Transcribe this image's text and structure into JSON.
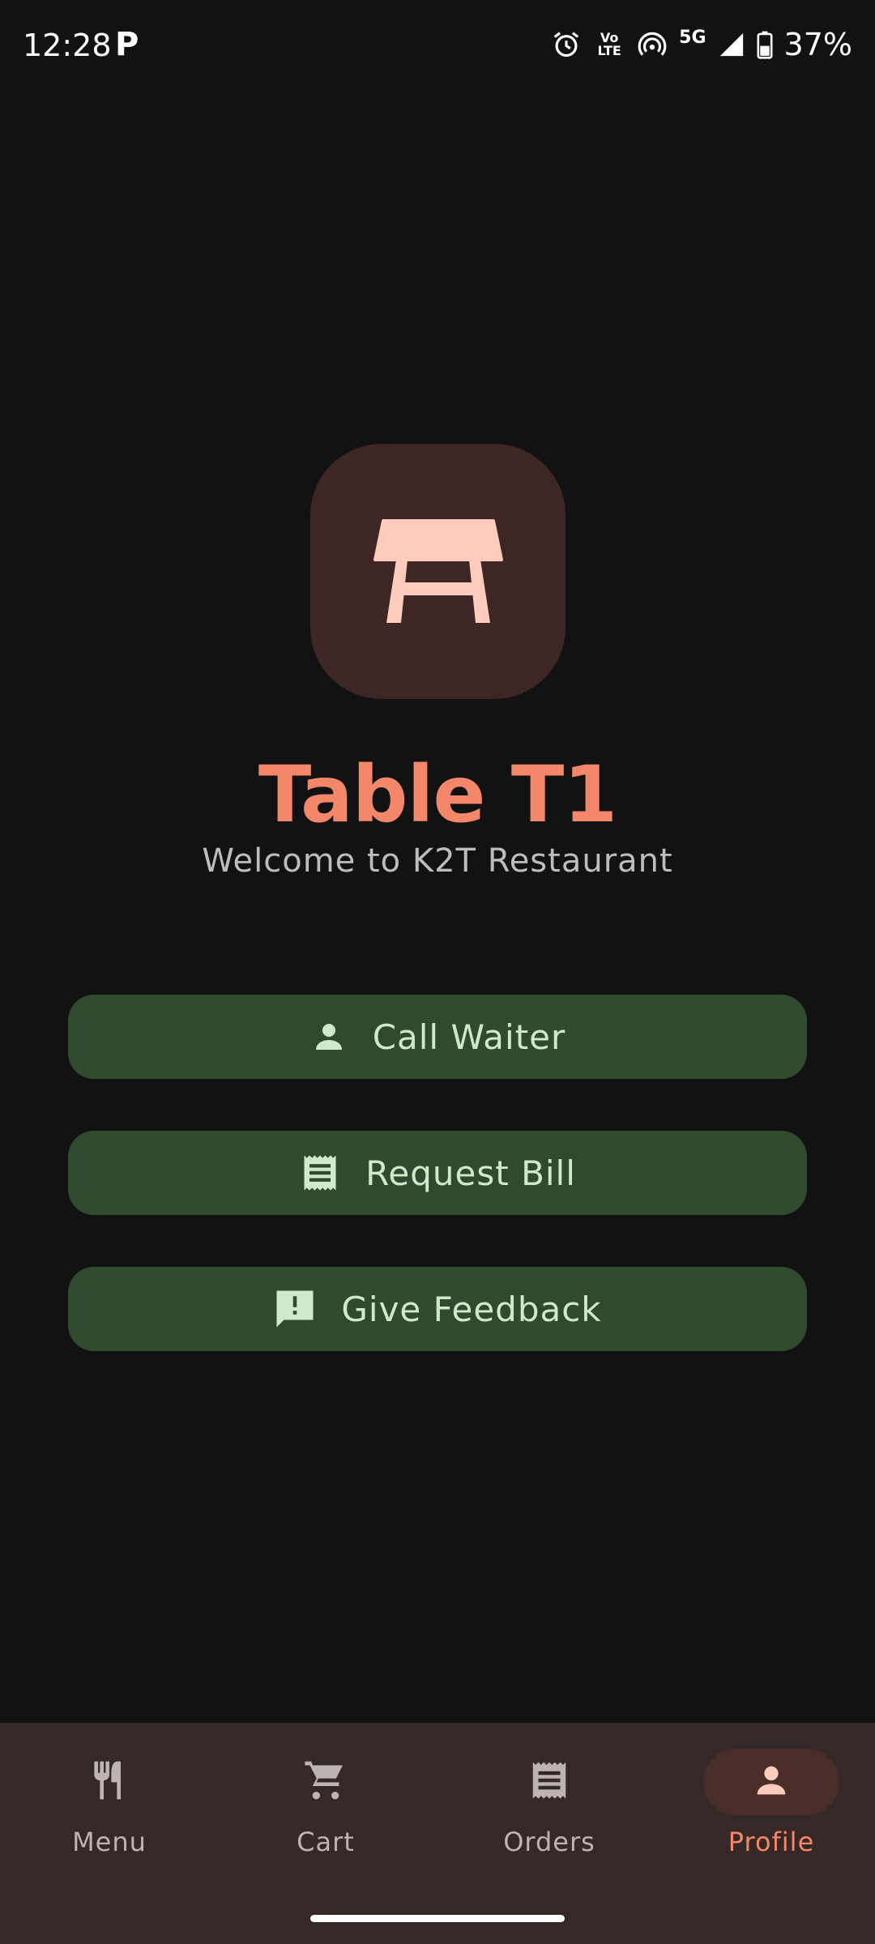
{
  "status_bar": {
    "time": "12:28",
    "app_indicator": "P",
    "volte_top": "Vo",
    "volte_bottom": "LTE",
    "network": "5G",
    "battery": "37%"
  },
  "hero": {
    "icon": "table-icon",
    "title": "Table T1",
    "subtitle": "Welcome to K2T Restaurant"
  },
  "actions": [
    {
      "label": "Call Waiter",
      "icon": "person-icon"
    },
    {
      "label": "Request Bill",
      "icon": "receipt-icon"
    },
    {
      "label": "Give Feedback",
      "icon": "feedback-icon"
    }
  ],
  "bottom_nav": {
    "items": [
      {
        "label": "Menu",
        "icon": "fork-knife-icon",
        "active": false
      },
      {
        "label": "Cart",
        "icon": "cart-icon",
        "active": false
      },
      {
        "label": "Orders",
        "icon": "receipt-icon",
        "active": false
      },
      {
        "label": "Profile",
        "icon": "person-icon",
        "active": true
      }
    ]
  },
  "colors": {
    "background": "#121212",
    "accent": "#f4876a",
    "button_bg": "#2e4a2f",
    "button_text": "#cfe9cf",
    "nav_bg": "#352826",
    "tile_bg": "#3e2624"
  }
}
